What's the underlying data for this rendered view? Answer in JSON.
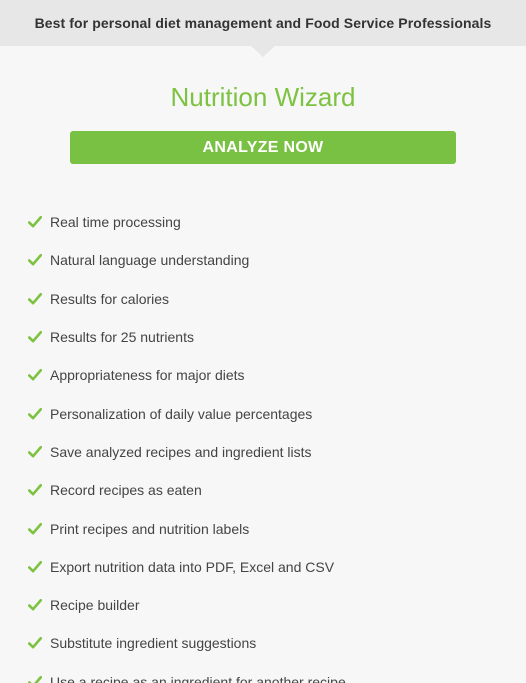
{
  "banner": {
    "text": "Best for personal diet management and Food Service Professionals"
  },
  "plan": {
    "title": "Nutrition Wizard",
    "cta_label": "ANALYZE NOW"
  },
  "colors": {
    "accent": "#7dc241",
    "button": "#79c143",
    "banner_bg": "#e7e7e7",
    "card_bg": "#f7f7f7"
  },
  "features": [
    {
      "icon": "checkmark-icon",
      "label": "Real time processing"
    },
    {
      "icon": "checkmark-icon",
      "label": "Natural language understanding"
    },
    {
      "icon": "checkmark-icon",
      "label": "Results for calories"
    },
    {
      "icon": "checkmark-icon",
      "label": "Results for 25 nutrients"
    },
    {
      "icon": "checkmark-icon",
      "label": "Appropriateness for major diets"
    },
    {
      "icon": "checkmark-icon",
      "label": "Personalization of daily value percentages"
    },
    {
      "icon": "checkmark-icon",
      "label": "Save analyzed recipes and ingredient lists"
    },
    {
      "icon": "checkmark-icon",
      "label": "Record recipes as eaten"
    },
    {
      "icon": "checkmark-icon",
      "label": "Print recipes and nutrition labels"
    },
    {
      "icon": "checkmark-icon",
      "label": "Export nutrition data into PDF, Excel and CSV"
    },
    {
      "icon": "checkmark-icon",
      "label": "Recipe builder"
    },
    {
      "icon": "checkmark-icon",
      "label": "Substitute ingredient suggestions"
    },
    {
      "icon": "checkmark-icon",
      "label": "Use a recipe as an ingredient for another recipe"
    }
  ]
}
